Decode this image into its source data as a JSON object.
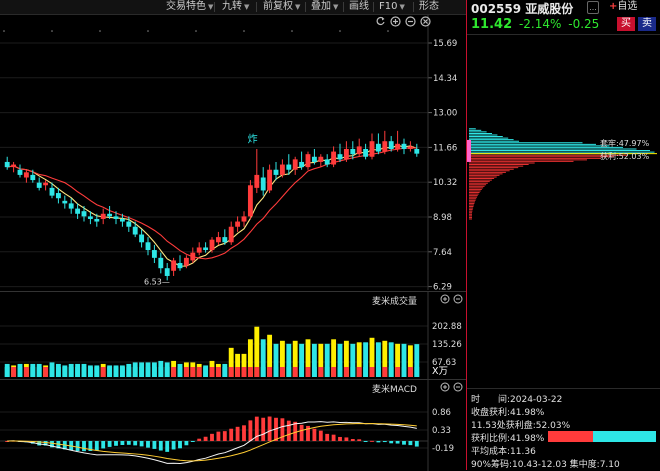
{
  "toolbar": {
    "items": [
      {
        "label": "交易特色",
        "caret": true
      },
      {
        "label": "九转",
        "caret": true
      },
      {
        "label": "前复权",
        "caret": true
      },
      {
        "label": "叠加",
        "caret": true
      },
      {
        "label": "画线",
        "caret": false
      },
      {
        "label": "F10",
        "caret": true
      },
      {
        "label": "形态",
        "caret": false
      }
    ],
    "icons": [
      "refresh-icon",
      "zoom-in-icon",
      "zoom-out-icon",
      "close-icon"
    ]
  },
  "stock": {
    "code": "002559",
    "name": "亚威股份",
    "price": "11.42",
    "change_pct": "-2.14%",
    "change": "-0.25",
    "buy_label": "买",
    "sell_label": "卖",
    "more_label": "...",
    "watch_label": "自选"
  },
  "colors": {
    "up": "#ff3b3b",
    "down": "#2ee6e6",
    "price_green": "#2ee62e",
    "volume_up": "#ffef00",
    "volume_down": "#2ee6e6",
    "ma5": "#ffe680",
    "ma10": "#ff3b3b",
    "accent_red": "#c8102e"
  },
  "main_chart": {
    "y_ticks": [
      "15.69",
      "14.34",
      "13.00",
      "11.66",
      "10.32",
      "8.98",
      "7.64",
      "6.29"
    ],
    "low_label": "6.53",
    "marker_label": "炸"
  },
  "volume_panel": {
    "title": "麦米成交量",
    "y_ticks": [
      "202.88",
      "135.26",
      "67.63"
    ],
    "unit": "X万"
  },
  "macd_panel": {
    "title": "麦米MACD",
    "y_ticks": [
      "0.86",
      "0.33",
      "-0.19"
    ]
  },
  "chip": {
    "cost_label": "套牢:47.97%",
    "profit_label": "获利:52.03%"
  },
  "chip_info": {
    "date": "时　　间:2024-03-22",
    "close_profit": "收盘获利:41.98%",
    "profit_at_price": "11.53处获利盘:52.03%",
    "profit_ratio_label": "获利比例:41.98%",
    "profit_ratio": 0.4198,
    "avg_cost": "平均成本:11.36",
    "concentration": "90%筹码:10.43-12.03 集中度:7.10"
  }
}
